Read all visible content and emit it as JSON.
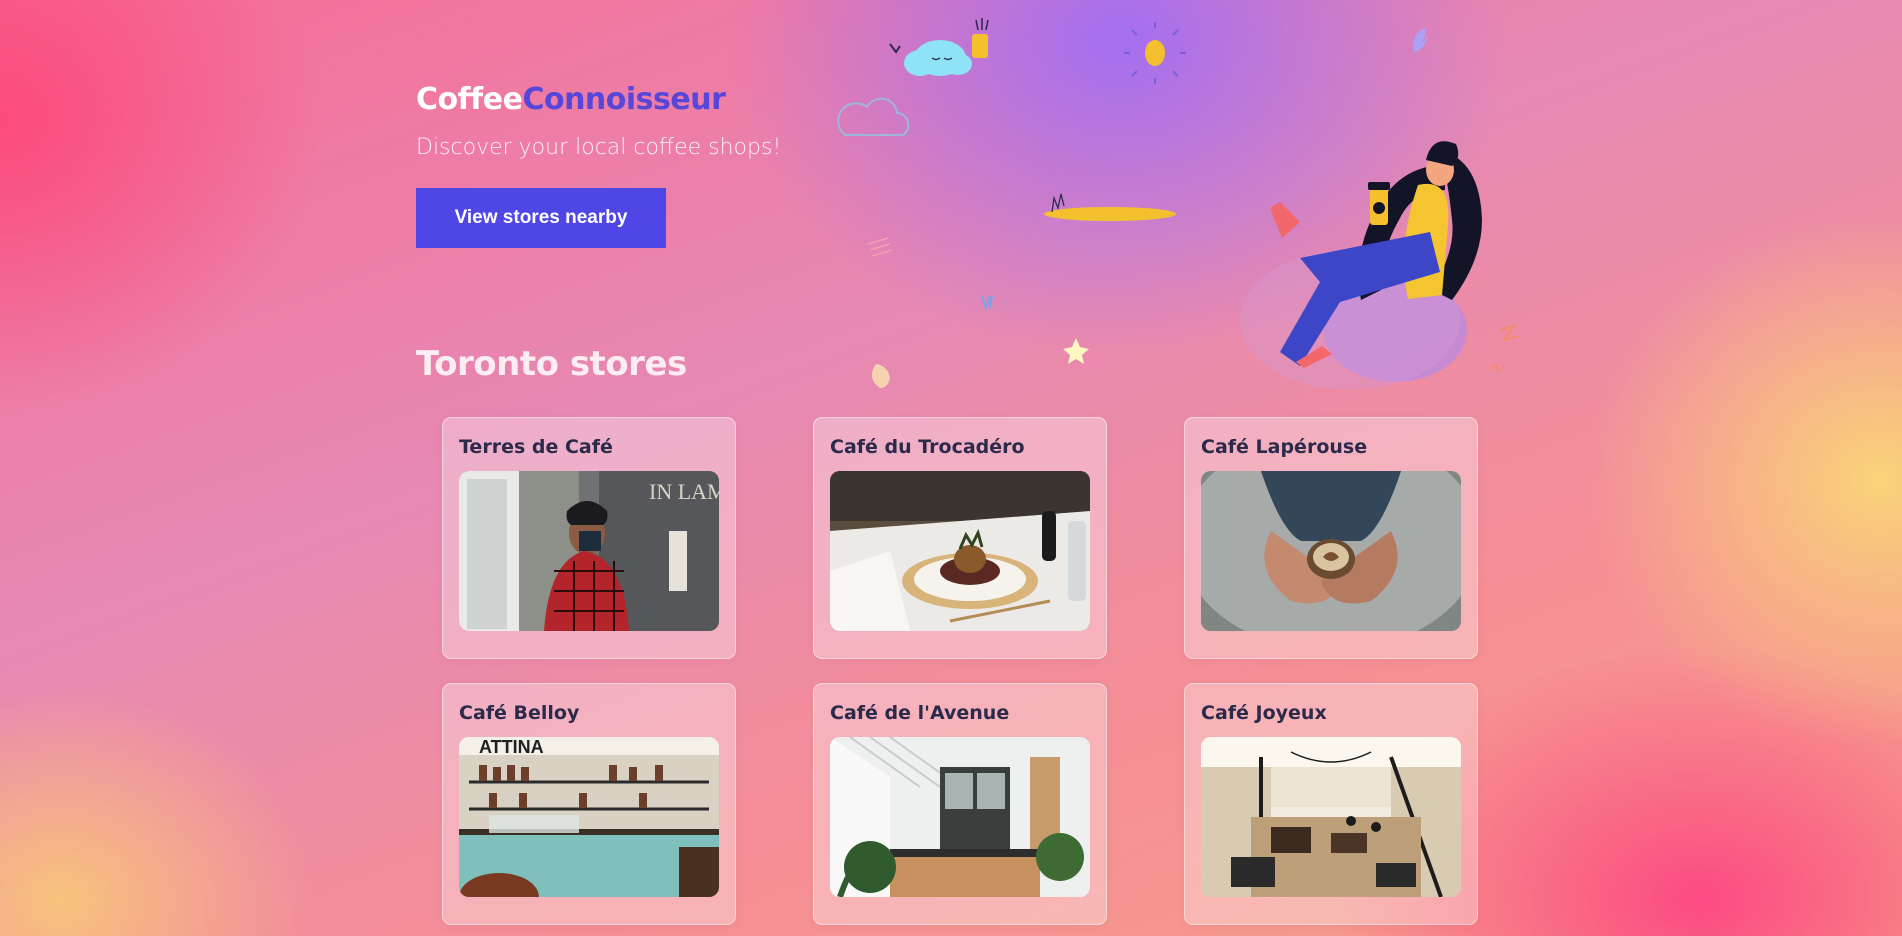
{
  "brand": {
    "part1": "Coffee",
    "part2": "Connoisseur"
  },
  "hero": {
    "subtitle": "Discover your local coffee shops!",
    "cta_label": "View stores nearby"
  },
  "section": {
    "title": "Toronto stores"
  },
  "stores": [
    {
      "name": "Terres de Café"
    },
    {
      "name": "Café du Trocadéro"
    },
    {
      "name": "Café Lapérouse"
    },
    {
      "name": "Café Belloy"
    },
    {
      "name": "Café de l'Avenue"
    },
    {
      "name": "Café Joyeux"
    }
  ],
  "colors": {
    "brand_accent": "#5646d9",
    "button": "#4f46e5",
    "card_title": "#2c2a4a"
  }
}
